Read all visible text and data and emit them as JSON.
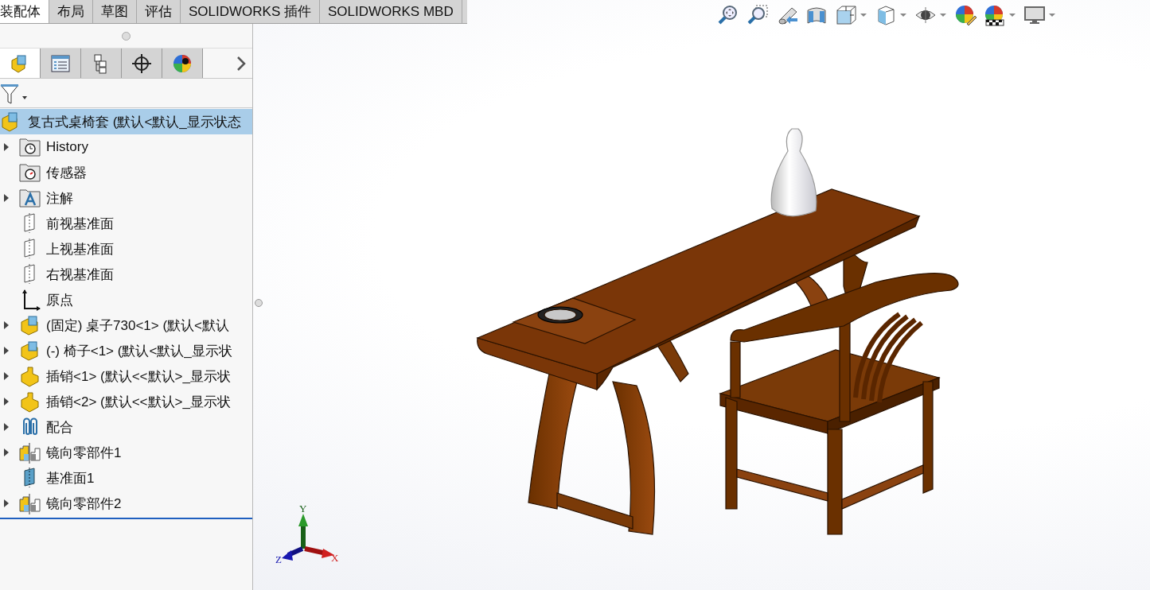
{
  "command_tabs": [
    {
      "label": "装配体",
      "selected": true
    },
    {
      "label": "布局",
      "selected": false
    },
    {
      "label": "草图",
      "selected": false
    },
    {
      "label": "评估",
      "selected": false
    },
    {
      "label": "SOLIDWORKS 插件",
      "selected": false
    },
    {
      "label": "SOLIDWORKS MBD",
      "selected": false
    }
  ],
  "panel_tabs": [
    {
      "kind": "feature-tree",
      "selected": true
    },
    {
      "kind": "property",
      "selected": false
    },
    {
      "kind": "configuration",
      "selected": false
    },
    {
      "kind": "target",
      "selected": false
    },
    {
      "kind": "appearance",
      "selected": false
    }
  ],
  "tree": [
    {
      "label": "复古式桌椅套 (默认<默认_显示状态",
      "kind": "assembly",
      "selected": true,
      "expandable": false
    },
    {
      "label": "History",
      "kind": "history",
      "selected": false,
      "expandable": true
    },
    {
      "label": "传感器",
      "kind": "sensor",
      "selected": false,
      "expandable": false
    },
    {
      "label": "注解",
      "kind": "annotation",
      "selected": false,
      "expandable": true
    },
    {
      "label": "前视基准面",
      "kind": "plane",
      "selected": false,
      "expandable": false
    },
    {
      "label": "上视基准面",
      "kind": "plane",
      "selected": false,
      "expandable": false
    },
    {
      "label": "右视基准面",
      "kind": "plane",
      "selected": false,
      "expandable": false
    },
    {
      "label": "原点",
      "kind": "origin",
      "selected": false,
      "expandable": false
    },
    {
      "label": "(固定) 桌子730<1> (默认<默认",
      "kind": "subassembly",
      "selected": false,
      "expandable": true
    },
    {
      "label": "(-) 椅子<1> (默认<默认_显示状",
      "kind": "subassembly",
      "selected": false,
      "expandable": true
    },
    {
      "label": "插销<1> (默认<<默认>_显示状",
      "kind": "part",
      "selected": false,
      "expandable": true
    },
    {
      "label": "插销<2> (默认<<默认>_显示状",
      "kind": "part",
      "selected": false,
      "expandable": true
    },
    {
      "label": "配合",
      "kind": "mates",
      "selected": false,
      "expandable": true
    },
    {
      "label": "镜向零部件1",
      "kind": "mirror",
      "selected": false,
      "expandable": true
    },
    {
      "label": "基准面1",
      "kind": "solid-plane",
      "selected": false,
      "expandable": false
    },
    {
      "label": "镜向零部件2",
      "kind": "mirror",
      "selected": false,
      "expandable": true
    }
  ],
  "triad": {
    "x": "X",
    "y": "Y",
    "z": "Z"
  }
}
